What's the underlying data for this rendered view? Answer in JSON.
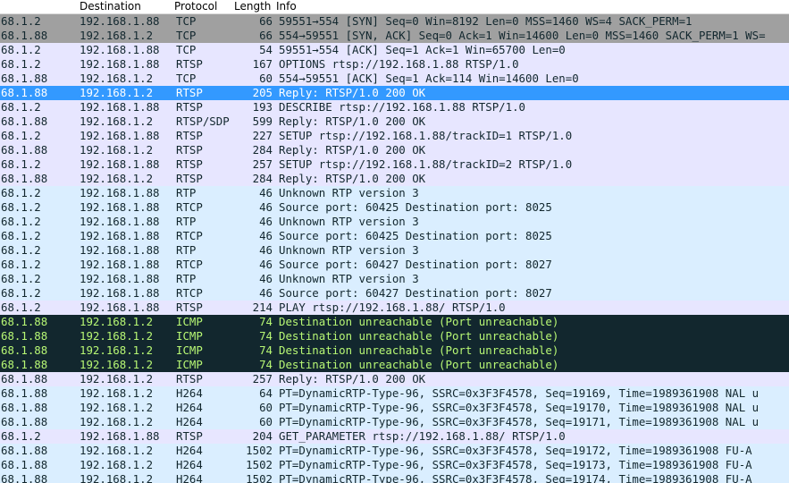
{
  "columns": {
    "destination": "Destination",
    "protocol": "Protocol",
    "length": "Length",
    "info": "Info"
  },
  "colors": {
    "tcp_syn_bg": "#a0a0a0",
    "tcp_bg": "#e7e6ff",
    "rtsp_bg": "#dae8fc",
    "rtp_bg": "#dae8fc",
    "udp_bg": "#daeeff",
    "icmp_error_bg": "#12272e",
    "icmp_error_fg": "#b7f774",
    "selected_bg": "#3399ff",
    "selected_fg": "#ffffff",
    "default_fg": "#12272e"
  },
  "packets": [
    {
      "source": "68.1.2",
      "destination": "192.168.1.88",
      "protocol": "TCP",
      "length": "66",
      "info": "59551→554 [SYN] Seq=0 Win=8192 Len=0 MSS=1460 WS=4 SACK_PERM=1",
      "style": "syn"
    },
    {
      "source": "68.1.88",
      "destination": "192.168.1.2",
      "protocol": "TCP",
      "length": "66",
      "info": "554→59551 [SYN, ACK] Seq=0 Ack=1 Win=14600 Len=0 MSS=1460 SACK_PERM=1 WS=",
      "style": "syn"
    },
    {
      "source": "68.1.2",
      "destination": "192.168.1.88",
      "protocol": "TCP",
      "length": "54",
      "info": "59551→554 [ACK] Seq=1 Ack=1 Win=65700 Len=0",
      "style": "tcp"
    },
    {
      "source": "68.1.2",
      "destination": "192.168.1.88",
      "protocol": "RTSP",
      "length": "167",
      "info": "OPTIONS rtsp://192.168.1.88 RTSP/1.0",
      "style": "tcp"
    },
    {
      "source": "68.1.88",
      "destination": "192.168.1.2",
      "protocol": "TCP",
      "length": "60",
      "info": "554→59551 [ACK] Seq=1 Ack=114 Win=14600 Len=0",
      "style": "tcp"
    },
    {
      "source": "68.1.88",
      "destination": "192.168.1.2",
      "protocol": "RTSP",
      "length": "205",
      "info": "Reply: RTSP/1.0 200 OK",
      "style": "selected"
    },
    {
      "source": "68.1.2",
      "destination": "192.168.1.88",
      "protocol": "RTSP",
      "length": "193",
      "info": "DESCRIBE rtsp://192.168.1.88 RTSP/1.0",
      "style": "tcp"
    },
    {
      "source": "68.1.88",
      "destination": "192.168.1.2",
      "protocol": "RTSP/SDP",
      "length": "599",
      "info": "Reply: RTSP/1.0 200 OK",
      "style": "tcp"
    },
    {
      "source": "68.1.2",
      "destination": "192.168.1.88",
      "protocol": "RTSP",
      "length": "227",
      "info": "SETUP rtsp://192.168.1.88/trackID=1 RTSP/1.0",
      "style": "tcp"
    },
    {
      "source": "68.1.88",
      "destination": "192.168.1.2",
      "protocol": "RTSP",
      "length": "284",
      "info": "Reply: RTSP/1.0 200 OK",
      "style": "tcp"
    },
    {
      "source": "68.1.2",
      "destination": "192.168.1.88",
      "protocol": "RTSP",
      "length": "257",
      "info": "SETUP rtsp://192.168.1.88/trackID=2 RTSP/1.0",
      "style": "tcp"
    },
    {
      "source": "68.1.88",
      "destination": "192.168.1.2",
      "protocol": "RTSP",
      "length": "284",
      "info": "Reply: RTSP/1.0 200 OK",
      "style": "tcp"
    },
    {
      "source": "68.1.2",
      "destination": "192.168.1.88",
      "protocol": "RTP",
      "length": "46",
      "info": "Unknown RTP version 3",
      "style": "udp"
    },
    {
      "source": "68.1.2",
      "destination": "192.168.1.88",
      "protocol": "RTCP",
      "length": "46",
      "info": "Source port: 60425  Destination port: 8025",
      "style": "udp"
    },
    {
      "source": "68.1.2",
      "destination": "192.168.1.88",
      "protocol": "RTP",
      "length": "46",
      "info": "Unknown RTP version 3",
      "style": "udp"
    },
    {
      "source": "68.1.2",
      "destination": "192.168.1.88",
      "protocol": "RTCP",
      "length": "46",
      "info": "Source port: 60425  Destination port: 8025",
      "style": "udp"
    },
    {
      "source": "68.1.2",
      "destination": "192.168.1.88",
      "protocol": "RTP",
      "length": "46",
      "info": "Unknown RTP version 3",
      "style": "udp"
    },
    {
      "source": "68.1.2",
      "destination": "192.168.1.88",
      "protocol": "RTCP",
      "length": "46",
      "info": "Source port: 60427  Destination port: 8027",
      "style": "udp"
    },
    {
      "source": "68.1.2",
      "destination": "192.168.1.88",
      "protocol": "RTP",
      "length": "46",
      "info": "Unknown RTP version 3",
      "style": "udp"
    },
    {
      "source": "68.1.2",
      "destination": "192.168.1.88",
      "protocol": "RTCP",
      "length": "46",
      "info": "Source port: 60427  Destination port: 8027",
      "style": "udp"
    },
    {
      "source": "68.1.2",
      "destination": "192.168.1.88",
      "protocol": "RTSP",
      "length": "214",
      "info": "PLAY rtsp://192.168.1.88/ RTSP/1.0",
      "style": "tcp"
    },
    {
      "source": "68.1.88",
      "destination": "192.168.1.2",
      "protocol": "ICMP",
      "length": "74",
      "info": "Destination unreachable (Port unreachable)",
      "style": "icmp"
    },
    {
      "source": "68.1.88",
      "destination": "192.168.1.2",
      "protocol": "ICMP",
      "length": "74",
      "info": "Destination unreachable (Port unreachable)",
      "style": "icmp"
    },
    {
      "source": "68.1.88",
      "destination": "192.168.1.2",
      "protocol": "ICMP",
      "length": "74",
      "info": "Destination unreachable (Port unreachable)",
      "style": "icmp"
    },
    {
      "source": "68.1.88",
      "destination": "192.168.1.2",
      "protocol": "ICMP",
      "length": "74",
      "info": "Destination unreachable (Port unreachable)",
      "style": "icmp"
    },
    {
      "source": "68.1.88",
      "destination": "192.168.1.2",
      "protocol": "RTSP",
      "length": "257",
      "info": "Reply: RTSP/1.0 200 OK",
      "style": "tcp"
    },
    {
      "source": "68.1.88",
      "destination": "192.168.1.2",
      "protocol": "H264",
      "length": "64",
      "info": "PT=DynamicRTP-Type-96, SSRC=0x3F3F4578, Seq=19169, Time=1989361908 NAL u",
      "style": "udp"
    },
    {
      "source": "68.1.88",
      "destination": "192.168.1.2",
      "protocol": "H264",
      "length": "60",
      "info": "PT=DynamicRTP-Type-96, SSRC=0x3F3F4578, Seq=19170, Time=1989361908 NAL u",
      "style": "udp"
    },
    {
      "source": "68.1.88",
      "destination": "192.168.1.2",
      "protocol": "H264",
      "length": "60",
      "info": "PT=DynamicRTP-Type-96, SSRC=0x3F3F4578, Seq=19171, Time=1989361908 NAL u",
      "style": "udp"
    },
    {
      "source": "68.1.2",
      "destination": "192.168.1.88",
      "protocol": "RTSP",
      "length": "204",
      "info": "GET_PARAMETER rtsp://192.168.1.88/ RTSP/1.0",
      "style": "tcp"
    },
    {
      "source": "68.1.88",
      "destination": "192.168.1.2",
      "protocol": "H264",
      "length": "1502",
      "info": "PT=DynamicRTP-Type-96, SSRC=0x3F3F4578, Seq=19172, Time=1989361908 FU-A",
      "style": "udp"
    },
    {
      "source": "68.1.88",
      "destination": "192.168.1.2",
      "protocol": "H264",
      "length": "1502",
      "info": "PT=DynamicRTP-Type-96, SSRC=0x3F3F4578, Seq=19173, Time=1989361908 FU-A",
      "style": "udp"
    },
    {
      "source": "68.1.88",
      "destination": "192.168.1.2",
      "protocol": "H264",
      "length": "1502",
      "info": "PT=DynamicRTP-Type-96, SSRC=0x3F3F4578, Seq=19174, Time=1989361908 FU-A",
      "style": "udp"
    }
  ]
}
